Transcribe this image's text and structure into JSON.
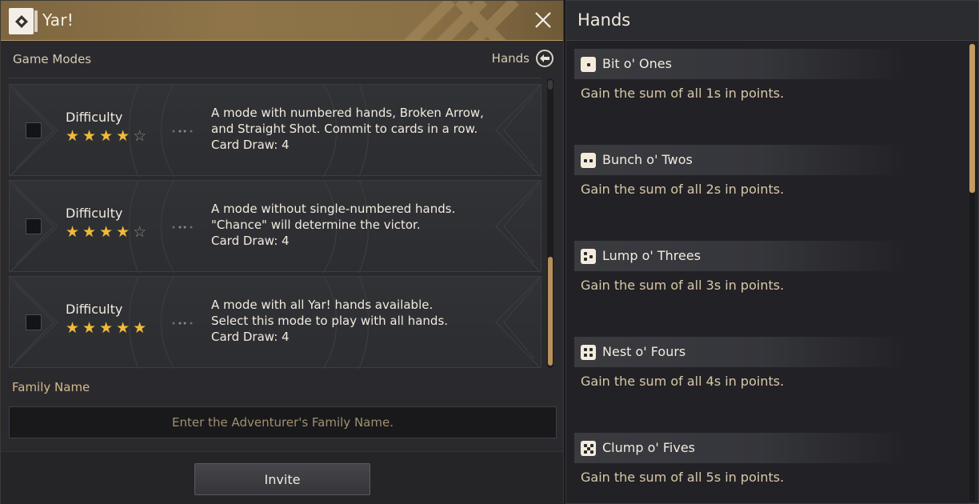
{
  "window": {
    "title": "Yar!",
    "app_icon": "card-diamond-icon",
    "close_icon": "close-icon"
  },
  "game_modes": {
    "heading": "Game Modes",
    "hands_link_label": "Hands",
    "hands_link_icon": "arrow-left-circle-icon",
    "difficulty_label": "Difficulty",
    "modes": [
      {
        "stars_filled": 4,
        "stars_total": 5,
        "stars": "★★★★☆",
        "desc_line1": "A mode with numbered hands, Broken Arrow,",
        "desc_line2": "and Straight Shot. Commit to cards in a row.",
        "card_draw": "Card Draw: 4",
        "selected": false
      },
      {
        "stars_filled": 4,
        "stars_total": 5,
        "stars": "★★★★☆",
        "desc_line1": "A mode without single-numbered hands.",
        "desc_line2": "\"Chance\" will determine the victor.",
        "card_draw": "Card Draw: 4",
        "selected": false
      },
      {
        "stars_filled": 5,
        "stars_total": 5,
        "stars": "★★★★★",
        "desc_line1": "A mode with all Yar! hands available.",
        "desc_line2": "Select this mode to play with all hands.",
        "card_draw": "Card Draw: 4",
        "selected": false
      }
    ]
  },
  "family": {
    "label": "Family Name",
    "placeholder": "Enter the Adventurer's Family Name.",
    "value": ""
  },
  "invite_button": "Invite",
  "hands_panel": {
    "title": "Hands",
    "hands": [
      {
        "name": "Bit o' Ones",
        "desc": "Gain the sum of all 1s in points.",
        "die_face": 1
      },
      {
        "name": "Bunch o' Twos",
        "desc": "Gain the sum of all 2s in points.",
        "die_face": 2
      },
      {
        "name": "Lump o' Threes",
        "desc": "Gain the sum of all 3s in points.",
        "die_face": 3
      },
      {
        "name": "Nest o' Fours",
        "desc": "Gain the sum of all 4s in points.",
        "die_face": 4
      },
      {
        "name": "Clump o' Fives",
        "desc": "Gain the sum of all 5s in points.",
        "die_face": 5
      }
    ]
  },
  "colors": {
    "accent_gold": "#c29c62",
    "title_bar_bronze": "#8e7448",
    "star_gold": "#f3b93a"
  }
}
